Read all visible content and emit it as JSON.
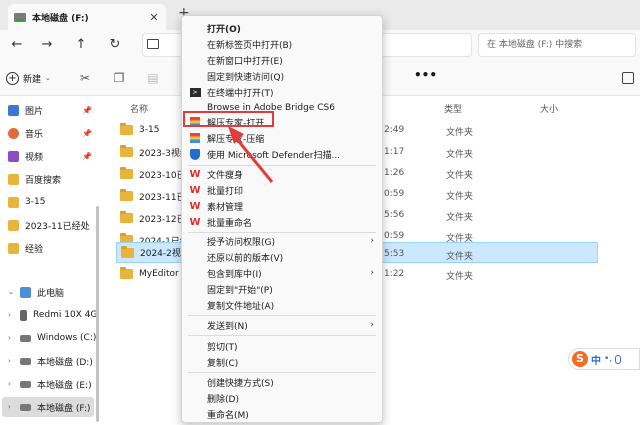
{
  "window": {
    "tab_title": "本地磁盘 (F:)",
    "tab_close": "✕",
    "new_tab": "+"
  },
  "nav": {
    "back": "←",
    "forward": "→",
    "up": "↑",
    "refresh": "↻",
    "search_placeholder": "在 本地磁盘 (F:) 中搜索"
  },
  "toolbar": {
    "new_label": "新建",
    "more": "•••"
  },
  "sidebar": {
    "quick_access": [
      {
        "label": "图片",
        "icon": "pictures-icon",
        "color": "#3a78d4",
        "pinned": true
      },
      {
        "label": "音乐",
        "icon": "music-icon",
        "color": "#e36a3b",
        "pinned": true
      },
      {
        "label": "视频",
        "icon": "video-icon",
        "color": "#8a4fc7",
        "pinned": true
      },
      {
        "label": "百度搜索",
        "icon": "folder-icon",
        "color": "#e9b43c",
        "pinned": false
      },
      {
        "label": "3-15",
        "icon": "folder-icon",
        "color": "#e9b43c",
        "pinned": false
      },
      {
        "label": "2023-11已经处",
        "icon": "folder-icon",
        "color": "#e9b43c",
        "pinned": false
      },
      {
        "label": "经验",
        "icon": "folder-icon",
        "color": "#e9b43c",
        "pinned": false
      }
    ],
    "this_pc": "此电脑",
    "drives": [
      {
        "label": "Redmi 10X 4G"
      },
      {
        "label": "Windows (C:)"
      },
      {
        "label": "本地磁盘 (D:)"
      },
      {
        "label": "本地磁盘 (E:)"
      },
      {
        "label": "本地磁盘 (F:)"
      }
    ]
  },
  "list": {
    "columns": {
      "name": "名称",
      "type": "类型",
      "size": "大小"
    },
    "rows": [
      {
        "name": "3-15",
        "date": "2:49",
        "type": "文件夹"
      },
      {
        "name": "2023-3视频",
        "date": "1:17",
        "type": "文件夹"
      },
      {
        "name": "2023-10已经",
        "date": "1:26",
        "type": "文件夹"
      },
      {
        "name": "2023-11已经",
        "date": "0:59",
        "type": "文件夹"
      },
      {
        "name": "2023-12已经",
        "date": "5:56",
        "type": "文件夹"
      },
      {
        "name": "2024-1已经",
        "date": "0:59",
        "type": "文件夹"
      },
      {
        "name": "2024-2视频",
        "date": "5:53",
        "type": "文件夹"
      },
      {
        "name": "MyEditor",
        "date": "1:22",
        "type": "文件夹"
      }
    ],
    "selected_index": 6
  },
  "menu": {
    "items": [
      {
        "label": "打开(O)",
        "bold": true
      },
      {
        "label": "在新标签页中打开(B)"
      },
      {
        "label": "在新窗口中打开(E)"
      },
      {
        "label": "固定到快速访问(Q)"
      },
      {
        "label": "在终端中打开(T)",
        "icon": "terminal-icon"
      },
      {
        "label": "Browse in Adobe Bridge CS6"
      },
      {
        "label": "解压专家-打开",
        "icon": "unzip-open-icon"
      },
      {
        "label": "解压专家-压缩",
        "icon": "unzip-compress-icon"
      },
      {
        "label": "使用 Microsoft Defender扫描...",
        "icon": "defender-shield-icon"
      },
      {
        "label": "文件瘦身",
        "icon": "wps-icon"
      },
      {
        "label": "批量打印",
        "icon": "wps-icon"
      },
      {
        "label": "素材管理",
        "icon": "wps-icon"
      },
      {
        "label": "批量重命名",
        "icon": "wps-icon"
      },
      {
        "label": "授予访问权限(G)",
        "submenu": true
      },
      {
        "label": "还原以前的版本(V)"
      },
      {
        "label": "包含到库中(I)",
        "submenu": true
      },
      {
        "label": "固定到\"开始\"(P)"
      },
      {
        "label": "复制文件地址(A)"
      },
      {
        "label": "发送到(N)",
        "submenu": true
      },
      {
        "label": "剪切(T)"
      },
      {
        "label": "复制(C)"
      },
      {
        "label": "创建快捷方式(S)"
      },
      {
        "label": "删除(D)"
      },
      {
        "label": "重命名(M)"
      }
    ],
    "wps_glyph": "W",
    "submenu_glyph": "›"
  },
  "ime": {
    "logo": "S",
    "lang": "中",
    "punct": "•,"
  },
  "colors": {
    "highlight": "#e23b3b",
    "accent": "#0067c0",
    "folder": "#e9b43c"
  }
}
